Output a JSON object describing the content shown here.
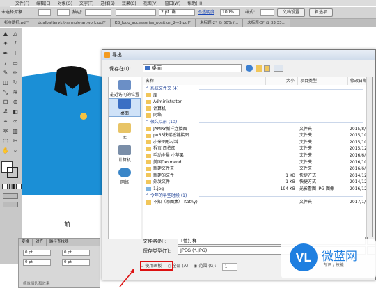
{
  "app": {
    "logo": "Ai"
  },
  "menu": {
    "items": [
      "文件(F)",
      "编辑(E)",
      "对象(O)",
      "文字(T)",
      "选择(S)",
      "效果(C)",
      "视图(V)",
      "窗口(W)",
      "帮助(H)"
    ]
  },
  "control": {
    "selection": "未选择对象",
    "stroke_label": "描边:",
    "stroke_value": "2 pt. 椭",
    "opacity_label": "不透明度",
    "opacity_value": "100%",
    "style_label": "样式:",
    "doc_setup": "文档设置",
    "prefs": "首选项"
  },
  "tabs": [
    "衫金助托.pdf*",
    "dualbatterykit-sample-artwork.pdf*",
    "KB_logo_accessories_position_2-v3.pdf*",
    "未标题-2* @ 50% (...",
    "未标题-3* @ 33.33..."
  ],
  "artboard": {
    "front_label": "前"
  },
  "panel": {
    "tabs": [
      "变换",
      "对齐",
      "路径查找器"
    ],
    "fields": [
      "0 pt",
      "0 pt",
      "0 pt",
      "0 pt"
    ],
    "footer": "缩放描边和效果"
  },
  "dialog": {
    "title": "导出",
    "look_in_label": "保存在(I):",
    "look_in_value": "桌面",
    "places": [
      "最近访问的位置",
      "桌面",
      "库",
      "计算机",
      "网络"
    ],
    "columns": [
      "名称",
      "大小",
      "项目类型",
      "修改日期"
    ],
    "rows": [
      {
        "kind": "group",
        "name": "⌃ 系统文件夹 (4)"
      },
      {
        "kind": "item",
        "name": "库",
        "size": "",
        "type": "",
        "date": ""
      },
      {
        "kind": "item",
        "name": "Administrator",
        "size": "",
        "type": "",
        "date": ""
      },
      {
        "kind": "item",
        "name": "计算机",
        "size": "",
        "type": "",
        "date": ""
      },
      {
        "kind": "item",
        "name": "网络",
        "size": "",
        "type": "",
        "date": ""
      },
      {
        "kind": "group",
        "name": "⌃ 很久以前 (10)"
      },
      {
        "kind": "item",
        "name": "JAMRY新样连接图",
        "size": "",
        "type": "文件夹",
        "date": "2015/8/5 10:08"
      },
      {
        "kind": "item",
        "name": "pu65铁碳板链接图",
        "size": "",
        "type": "文件夹",
        "date": "2015/10/29 14:27"
      },
      {
        "kind": "item",
        "name": "小米图形材料",
        "size": "",
        "type": "文件夹",
        "date": "2015/10/29 14:31"
      },
      {
        "kind": "item",
        "name": "拆页 西拍印",
        "size": "",
        "type": "文件夹",
        "date": "2015/12/4 9:58"
      },
      {
        "kind": "item",
        "name": "毛动全量 小苹果",
        "size": "",
        "type": "文件夹",
        "date": "2016/6/10 19:20"
      },
      {
        "kind": "item",
        "name": "美国Desmend",
        "size": "",
        "type": "文件夹",
        "date": "2016/10/4 11:08"
      },
      {
        "kind": "item",
        "name": "新建文件夹",
        "size": "",
        "type": "文件夹",
        "date": "2016/6/10 16:49"
      },
      {
        "kind": "item",
        "name": "新建的文件",
        "size": "1 KB",
        "type": "快捷方式",
        "date": "2014/12/11 16:34"
      },
      {
        "kind": "item",
        "name": "外发文件",
        "size": "1 KB",
        "type": "快捷方式",
        "date": "2014/12/11 16:34"
      },
      {
        "kind": "item",
        "name": "1.jpg",
        "size": "194 KB",
        "type": "光影看图 JPG 图像",
        "date": "2016/12/16 18:08"
      },
      {
        "kind": "group",
        "name": "⌃ 今年的早些时候 (1)"
      },
      {
        "kind": "item",
        "name": "不知（添图集）-Kathy)",
        "size": "",
        "type": "文件夹",
        "date": "2017/1/13 11:01"
      }
    ],
    "filename_label": "文件名(N):",
    "filename_value": "T恤打样",
    "filetype_label": "保存类型(T):",
    "filetype_value": "JPEG (*.JPG)",
    "use_artboards": "使用画板",
    "all_label": "全部 (A)",
    "range_label": "范围 (G):",
    "range_value": "1"
  },
  "watermark": {
    "brand": "微蓝网",
    "sub": "专识 / 技能"
  }
}
